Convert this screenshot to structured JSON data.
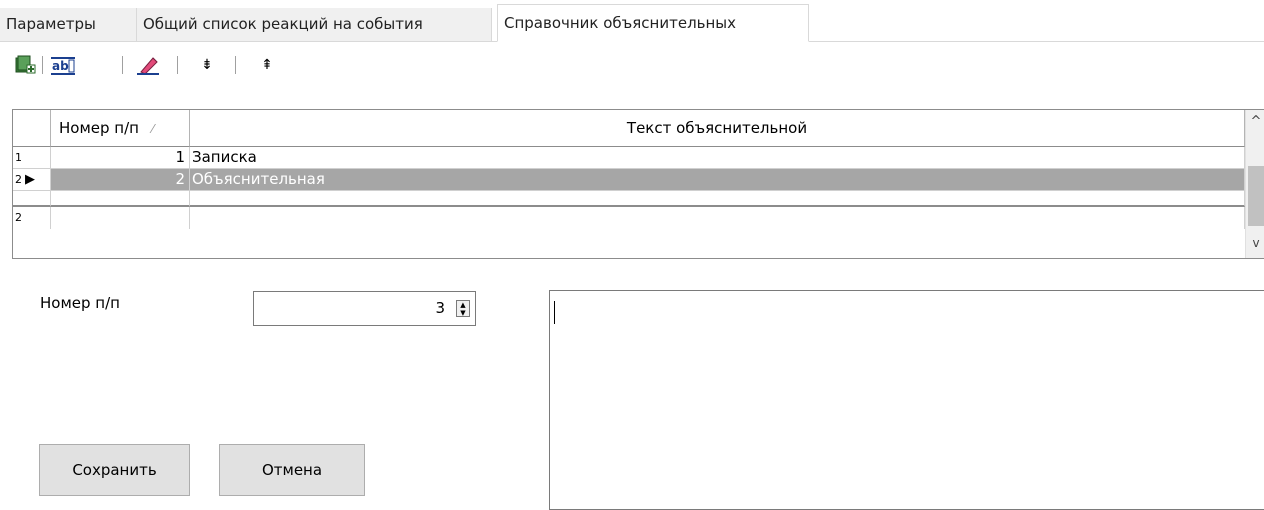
{
  "tabs": [
    {
      "label": "Параметры",
      "active": false
    },
    {
      "label": "Общий список реакций на события",
      "active": false
    },
    {
      "label": "Справочник объяснительных",
      "active": true
    }
  ],
  "toolbar": {
    "buttons": [
      {
        "icon": "add-record-icon"
      },
      {
        "icon": "edit-text-icon"
      },
      {
        "icon": "erase-icon"
      },
      {
        "icon": "move-down-icon",
        "glyph": "⇟"
      },
      {
        "icon": "move-up-icon",
        "glyph": "⇞"
      }
    ]
  },
  "grid": {
    "columns": [
      {
        "label": "Номер п/п",
        "sort_glyph": "⁄"
      },
      {
        "label": "Текст объяснительной"
      }
    ],
    "rows": [
      {
        "indicator": "1",
        "num": "1",
        "text": "Записка",
        "selected": false
      },
      {
        "indicator": "2",
        "num": "2",
        "text": "Объяснительная",
        "selected": true
      }
    ],
    "footer_indicator": "2",
    "scroll_up_glyph": "^",
    "scroll_down_glyph": "v"
  },
  "form": {
    "num_label": "Номер п/п",
    "num_value": "3",
    "text_value": "",
    "save_label": "Сохранить",
    "cancel_label": "Отмена"
  },
  "colors": {
    "selected_row": "#a6a6a6",
    "border": "#8c8c8c"
  }
}
